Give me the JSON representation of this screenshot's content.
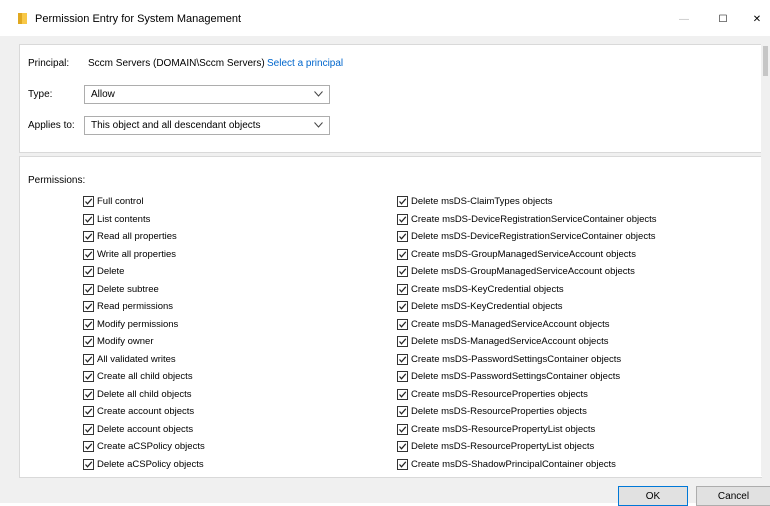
{
  "window": {
    "title": "Permission Entry for System Management",
    "minimize_glyph": "—",
    "maximize_glyph": "☐",
    "close_glyph": "✕"
  },
  "principal": {
    "label": "Principal:",
    "value": "Sccm Servers (DOMAIN\\Sccm Servers)",
    "link": "Select a principal"
  },
  "type": {
    "label": "Type:",
    "value": "Allow"
  },
  "applies_to": {
    "label": "Applies to:",
    "value": "This object and all descendant objects"
  },
  "permissions": {
    "label": "Permissions:",
    "left": [
      {
        "label": "Full control",
        "checked": true
      },
      {
        "label": "List contents",
        "checked": true
      },
      {
        "label": "Read all properties",
        "checked": true
      },
      {
        "label": "Write all properties",
        "checked": true
      },
      {
        "label": "Delete",
        "checked": true
      },
      {
        "label": "Delete subtree",
        "checked": true
      },
      {
        "label": "Read permissions",
        "checked": true
      },
      {
        "label": "Modify permissions",
        "checked": true
      },
      {
        "label": "Modify owner",
        "checked": true
      },
      {
        "label": "All validated writes",
        "checked": true
      },
      {
        "label": "Create all child objects",
        "checked": true
      },
      {
        "label": "Delete all child objects",
        "checked": true
      },
      {
        "label": "Create account objects",
        "checked": true
      },
      {
        "label": "Delete account objects",
        "checked": true
      },
      {
        "label": "Create aCSPolicy objects",
        "checked": true
      },
      {
        "label": "Delete aCSPolicy objects",
        "checked": true
      }
    ],
    "right": [
      {
        "label": "Delete msDS-ClaimTypes objects",
        "checked": true
      },
      {
        "label": "Create msDS-DeviceRegistrationServiceContainer objects",
        "checked": true
      },
      {
        "label": "Delete msDS-DeviceRegistrationServiceContainer objects",
        "checked": true
      },
      {
        "label": "Create msDS-GroupManagedServiceAccount objects",
        "checked": true
      },
      {
        "label": "Delete msDS-GroupManagedServiceAccount objects",
        "checked": true
      },
      {
        "label": "Create msDS-KeyCredential objects",
        "checked": true
      },
      {
        "label": "Delete msDS-KeyCredential objects",
        "checked": true
      },
      {
        "label": "Create msDS-ManagedServiceAccount objects",
        "checked": true
      },
      {
        "label": "Delete msDS-ManagedServiceAccount objects",
        "checked": true
      },
      {
        "label": "Create msDS-PasswordSettingsContainer objects",
        "checked": true
      },
      {
        "label": "Delete msDS-PasswordSettingsContainer objects",
        "checked": true
      },
      {
        "label": "Create msDS-ResourceProperties objects",
        "checked": true
      },
      {
        "label": "Delete msDS-ResourceProperties objects",
        "checked": true
      },
      {
        "label": "Create msDS-ResourcePropertyList objects",
        "checked": true
      },
      {
        "label": "Delete msDS-ResourcePropertyList objects",
        "checked": true
      },
      {
        "label": "Create msDS-ShadowPrincipalContainer objects",
        "checked": true
      }
    ]
  },
  "buttons": {
    "ok": "OK",
    "cancel": "Cancel"
  },
  "colors": {
    "accent": "#0078d7",
    "link": "#0066cc",
    "folder": "#f8c848",
    "dialog_bg": "#f0f0f0"
  }
}
